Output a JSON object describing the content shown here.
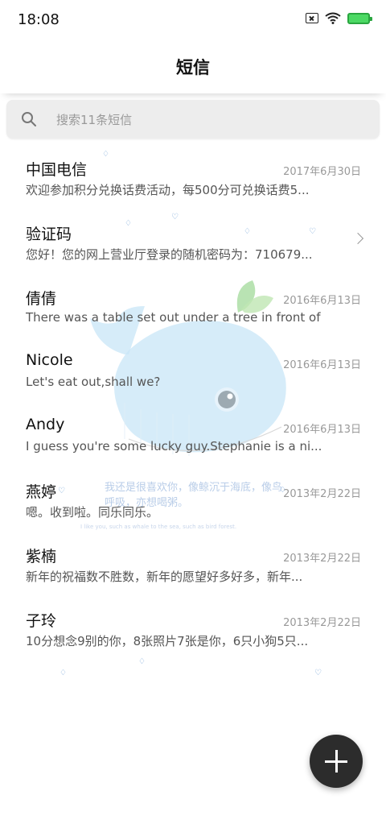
{
  "status_bar": {
    "time": "18:08"
  },
  "header": {
    "title": "短信"
  },
  "search": {
    "placeholder": "搜索11条短信"
  },
  "messages": [
    {
      "sender": "中国电信",
      "date": "2017年6月30日",
      "preview": "欢迎参加积分兑换话费活动，每500分可兑换话费5..."
    },
    {
      "sender": "验证码",
      "date": "",
      "preview": "您好！您的网上营业厅登录的随机密码为：710679..."
    },
    {
      "sender": "倩倩",
      "date": "2016年6月13日",
      "preview": "There was a table set out under a tree in front of ..."
    },
    {
      "sender": "Nicole",
      "date": "2016年6月13日",
      "preview": "Let's eat out,shall we?"
    },
    {
      "sender": "Andy",
      "date": "2016年6月13日",
      "preview": "I guess you're some lucky guy.Stephanie is a ni..."
    },
    {
      "sender": "燕婷",
      "date": "2013年2月22日",
      "preview": "嗯。收到啦。同乐同乐。"
    },
    {
      "sender": "紫楠",
      "date": "2013年2月22日",
      "preview": "新年的祝福数不胜数，新年的愿望好多好多，新年..."
    },
    {
      "sender": "子玲",
      "date": "2013年2月22日",
      "preview": "10分想念9别的你，8张照片7张是你，6只小狗5只..."
    }
  ],
  "wallpaper": {
    "caption": "我还是很喜欢你，像鲸沉于海底，像鸟呼吸，亦想喝粥。",
    "caption_en": "I like you, such as whale to the sea, such as bird forest."
  },
  "colors": {
    "fab": "#2c2c2c",
    "battery": "#4cd964",
    "whale": "#bfe3f7"
  },
  "icons": {
    "fab": "plus-icon",
    "search": "search-icon",
    "arrow": "chevron-right-icon"
  }
}
